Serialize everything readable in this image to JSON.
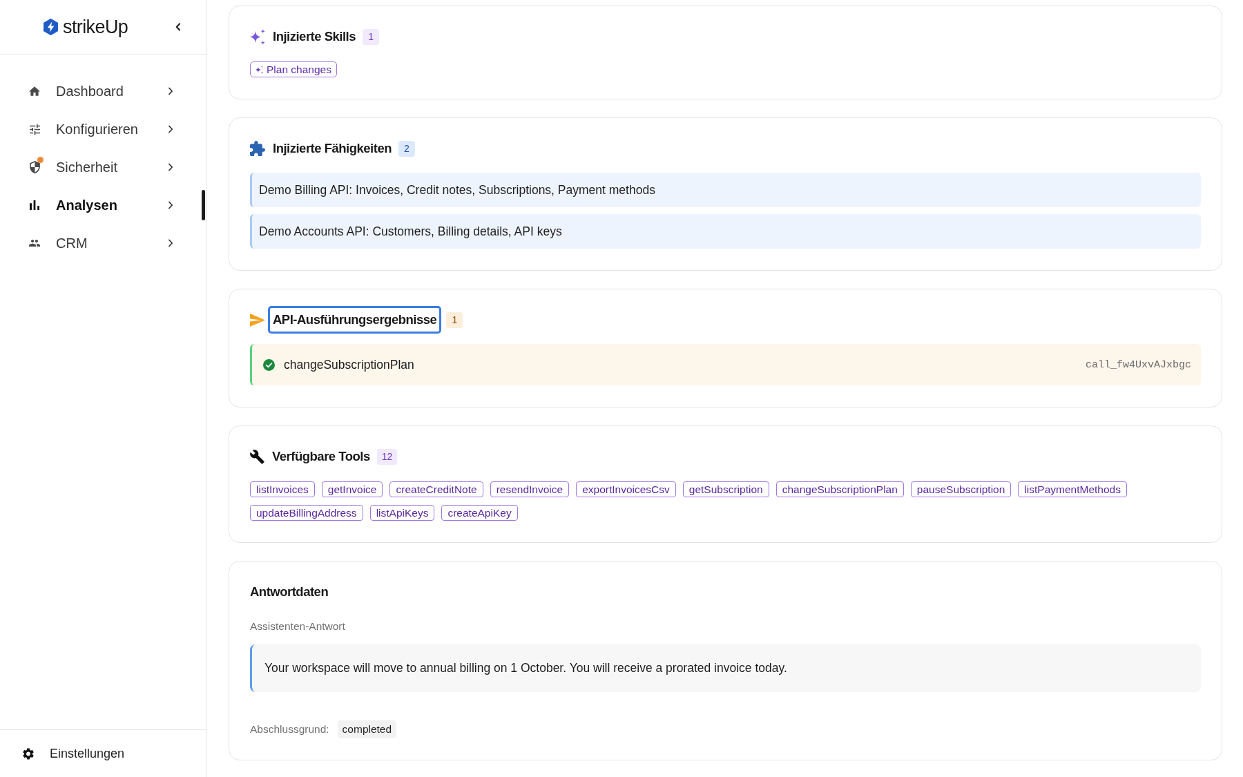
{
  "sidebar": {
    "logo": {
      "text": "strikeUp"
    },
    "items": [
      {
        "label": "Dashboard",
        "selected": false,
        "notification": false
      },
      {
        "label": "Konfigurieren",
        "selected": false,
        "notification": false
      },
      {
        "label": "Sicherheit",
        "selected": false,
        "notification": true
      },
      {
        "label": "Analysen",
        "selected": true,
        "notification": false
      },
      {
        "label": "CRM",
        "selected": false,
        "notification": false
      }
    ],
    "footer_item": {
      "label": "Einstellungen"
    }
  },
  "sections": [
    {
      "kind": "skills",
      "title": "Injizierte Skills",
      "count": "1",
      "focused": false,
      "skills": [
        "Plan changes"
      ]
    },
    {
      "kind": "capabilities",
      "title": "Injizierte Fähigkeiten",
      "count": "2",
      "focused": false,
      "items": [
        "Demo Billing API: Invoices, Credit notes, Subscriptions, Payment methods",
        "Demo Accounts API: Customers, Billing details, API keys"
      ]
    },
    {
      "kind": "results",
      "title": "API-Ausführungsergebnisse",
      "count": "1",
      "focused": true,
      "results": [
        {
          "name": "changeSubscriptionPlan",
          "call_id": "call_fw4UxvAJxbgc",
          "succeeded": true
        }
      ]
    },
    {
      "kind": "tools",
      "title": "Verfügbare Tools",
      "count": "12",
      "focused": false,
      "tools": [
        "listInvoices",
        "getInvoice",
        "createCreditNote",
        "resendInvoice",
        "exportInvoicesCsv",
        "getSubscription",
        "changeSubscriptionPlan",
        "pauseSubscription",
        "listPaymentMethods",
        "updateBillingAddress",
        "listApiKeys",
        "createApiKey"
      ]
    },
    {
      "kind": "response",
      "title": "Antwortdaten",
      "focused": false,
      "label": "Assistenten-Antwort",
      "message": "Your workspace will move to annual billing on 1 October. You will receive a prorated invoice today.",
      "finish_reason": {
        "label": "Abschlussgrund:",
        "value": "completed"
      }
    }
  ]
}
